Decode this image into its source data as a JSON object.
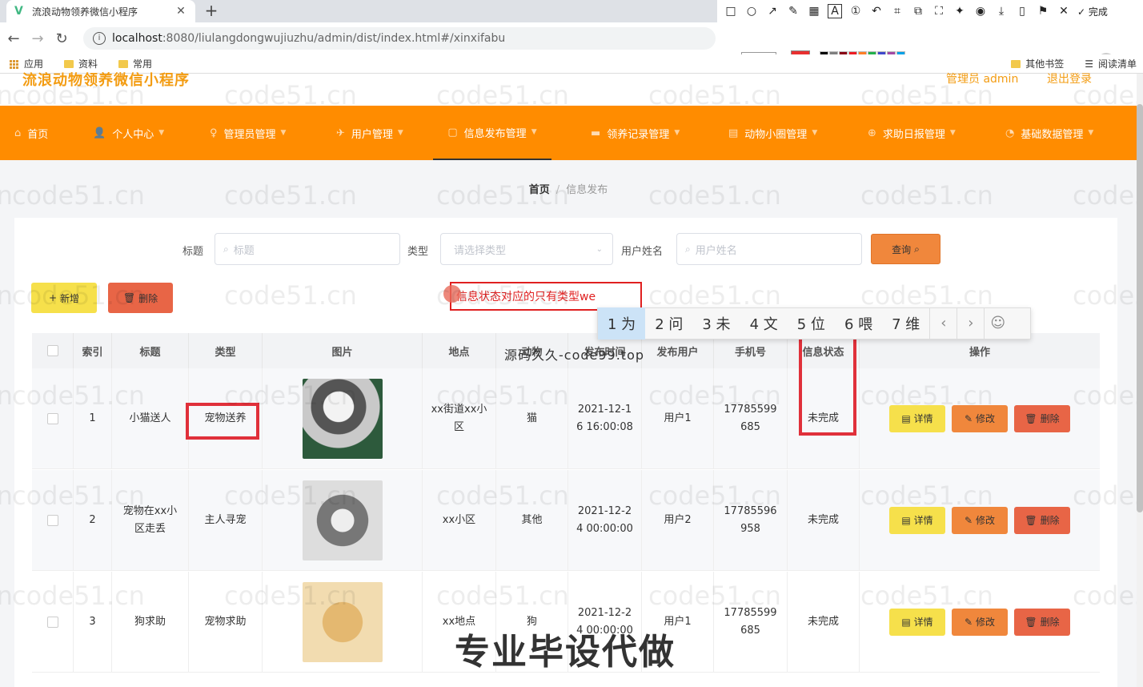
{
  "browser": {
    "tab_title": "流浪动物领养微信小程序",
    "url_host": "localhost",
    "url_rest": ":8080/liulangdongwujiuzhu/admin/dist/index.html#/xinxifabu",
    "font_size": "12",
    "annot_done": "完成",
    "bookmarks": [
      {
        "label": "应用"
      },
      {
        "label": "资料"
      },
      {
        "label": "常用"
      }
    ],
    "bookmarks_right": [
      "其他书签",
      "阅读清单"
    ],
    "palette": [
      "#000000",
      "#7f7f7f",
      "#880015",
      "#ed1c24",
      "#ff7f27",
      "#22b14c",
      "#3f48cc",
      "#a349a4",
      "#00a2e8",
      "#ffffff",
      "#c3c3c3",
      "#b97a57",
      "#e83030",
      "#fff200",
      "#b5e61d",
      "#99d9ea",
      "#7092be",
      "#c8bfe7"
    ]
  },
  "header": {
    "site_title": "流浪动物领养微信小程序",
    "admin_label": "管理员 admin",
    "logout_label": "退出登录"
  },
  "nav": [
    {
      "label": "首页",
      "icon": "home-icon"
    },
    {
      "label": "个人中心",
      "icon": "user-icon"
    },
    {
      "label": "管理员管理",
      "icon": "admin-icon"
    },
    {
      "label": "用户管理",
      "icon": "users-icon"
    },
    {
      "label": "信息发布管理",
      "icon": "info-icon"
    },
    {
      "label": "领养记录管理",
      "icon": "record-icon"
    },
    {
      "label": "动物小圈管理",
      "icon": "circle-icon"
    },
    {
      "label": "求助日报管理",
      "icon": "help-icon"
    },
    {
      "label": "基础数据管理",
      "icon": "data-icon"
    }
  ],
  "breadcrumb": {
    "home": "首页",
    "current": "信息发布"
  },
  "search": {
    "title_label": "标题",
    "title_placeholder": "标题",
    "type_label": "类型",
    "type_placeholder": "请选择类型",
    "user_label": "用户姓名",
    "user_placeholder": "用户姓名",
    "query_label": "查询"
  },
  "actions": {
    "add_label": "新增",
    "delete_label": "删除"
  },
  "ime": {
    "text": "信息状态对应的只有类型we",
    "candidates": [
      "1 为",
      "2 问",
      "3 未",
      "4 文",
      "5 位",
      "6 喂",
      "7 维"
    ]
  },
  "table": {
    "headers": [
      "索引",
      "标题",
      "类型",
      "图片",
      "地点",
      "动物",
      "发布时间",
      "发布用户",
      "手机号",
      "信息状态",
      "操作"
    ],
    "rows": [
      {
        "index": "1",
        "title": "小猫送人",
        "type": "宠物送养",
        "location": "xx街道xx小区",
        "animal": "猫",
        "time": "2021-12-16 16:00:08",
        "user": "用户1",
        "phone": "17785599685",
        "status": "未完成"
      },
      {
        "index": "2",
        "title": "宠物在xx小区走丢",
        "type": "主人寻宠",
        "location": "xx小区",
        "animal": "其他",
        "time": "2021-12-24 00:00:00",
        "user": "用户2",
        "phone": "17785596958",
        "status": "未完成"
      },
      {
        "index": "3",
        "title": "狗求助",
        "type": "宠物求助",
        "location": "xx地点",
        "animal": "狗",
        "time": "2021-12-24 00:00:00",
        "user": "用户1",
        "phone": "17785599685",
        "status": "未完成"
      }
    ],
    "op_detail": "详情",
    "op_edit": "修改",
    "op_delete": "删除"
  },
  "overlay": {
    "watermark_small": "源码久久-code99.top",
    "watermark_big": "专业毕设代做",
    "tile": "code51.cn"
  }
}
